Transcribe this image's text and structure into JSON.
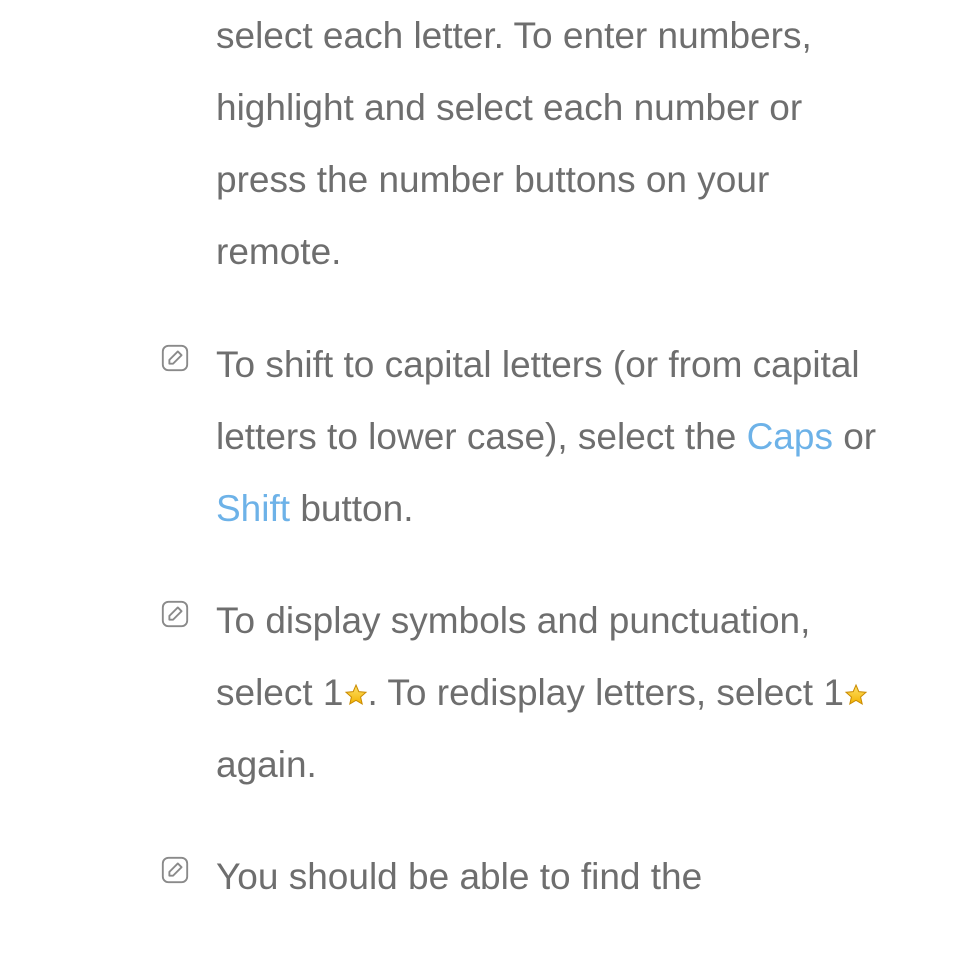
{
  "items": [
    {
      "parts": [
        {
          "type": "text",
          "text": "select each letter. To enter numbers, highlight and select each number or press the number buttons on your remote."
        }
      ],
      "hasIcon": false
    },
    {
      "parts": [
        {
          "type": "text",
          "text": "To shift to capital letters (or from capital letters to lower case), select the "
        },
        {
          "type": "highlight",
          "text": "Caps"
        },
        {
          "type": "text",
          "text": " or "
        },
        {
          "type": "highlight",
          "text": "Shift"
        },
        {
          "type": "text",
          "text": " button."
        }
      ],
      "hasIcon": true
    },
    {
      "parts": [
        {
          "type": "text",
          "text": "To display symbols and punctuation, select 1"
        },
        {
          "type": "star"
        },
        {
          "type": "text",
          "text": ". To redisplay letters, select 1"
        },
        {
          "type": "star"
        },
        {
          "type": "text",
          "text": " again."
        }
      ],
      "hasIcon": true
    },
    {
      "parts": [
        {
          "type": "text",
          "text": "You should be able to find the"
        }
      ],
      "hasIcon": true
    }
  ]
}
